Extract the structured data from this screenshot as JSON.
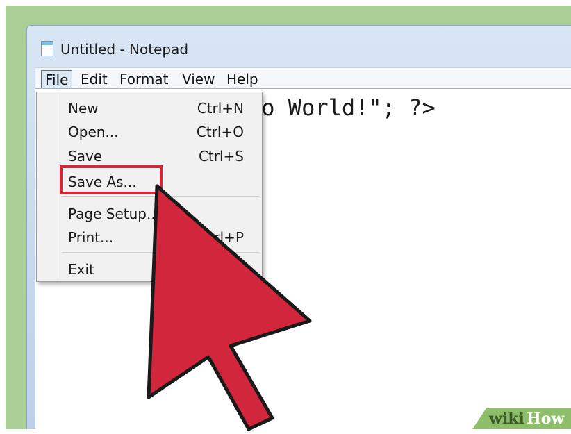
{
  "window": {
    "title": "Untitled - Notepad"
  },
  "menubar": {
    "items": [
      "File",
      "Edit",
      "Format",
      "View",
      "Help"
    ]
  },
  "editor": {
    "text": "lo World!\"; ?>"
  },
  "file_menu": {
    "items": [
      {
        "label": "New",
        "shortcut": "Ctrl+N"
      },
      {
        "label": "Open...",
        "shortcut": "Ctrl+O"
      },
      {
        "label": "Save",
        "shortcut": "Ctrl+S"
      },
      {
        "label": "Save As...",
        "shortcut": ""
      },
      {
        "label": "Page Setup...",
        "shortcut": ""
      },
      {
        "label": "Print...",
        "shortcut": "Ctrl+P"
      },
      {
        "label": "Exit",
        "shortcut": ""
      }
    ]
  },
  "watermark": {
    "wiki": "wiki",
    "how": "How"
  },
  "colors": {
    "highlight": "#d1263b",
    "cursor": "#d1263b",
    "background": "#a9cf96"
  },
  "icons": {
    "title": "notepad-icon",
    "pointer": "arrow-cursor-icon"
  }
}
